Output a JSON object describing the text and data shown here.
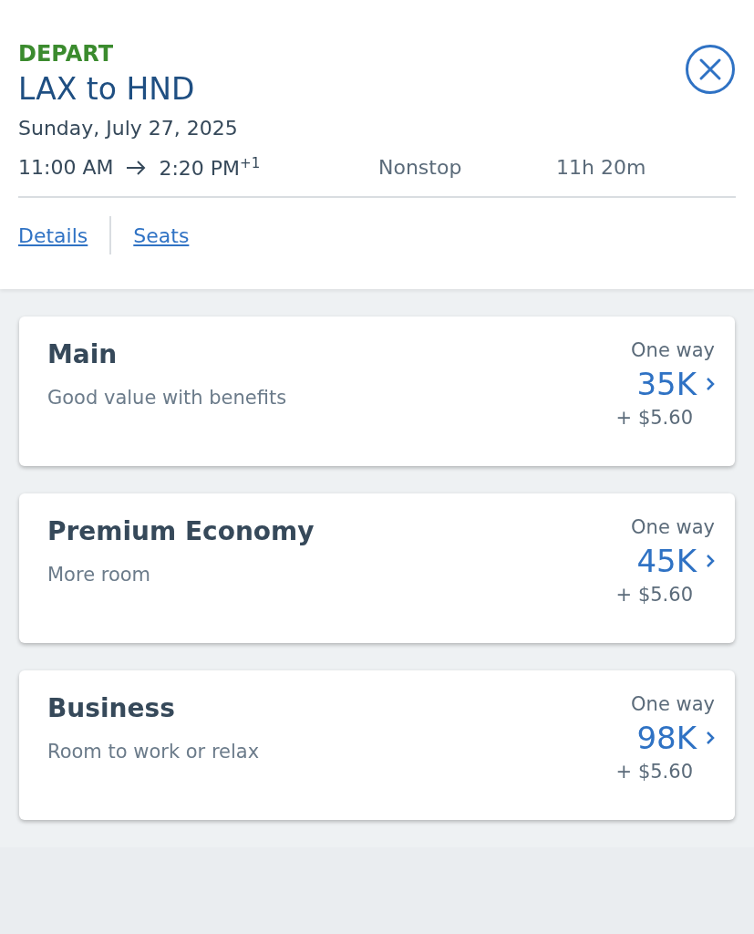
{
  "header": {
    "label": "DEPART",
    "route": "LAX to HND",
    "date": "Sunday, July 27, 2025",
    "depart_time": "11:00 AM",
    "arrive_time": "2:20 PM$^{+1}$",
    "stops": "Nonstop",
    "duration": "11h 20m",
    "links": [
      "Details",
      "Seats"
    ]
  },
  "fares": [
    {
      "cabin": "Main",
      "description": "Good value with benefits",
      "trip": "One way",
      "price": "35K",
      "fees": "+ $5.60"
    },
    {
      "cabin": "Premium Economy",
      "description": "More room",
      "trip": "One way",
      "price": "45K",
      "fees": "+ $5.60"
    },
    {
      "cabin": "Business",
      "description": "Room to work or relax",
      "trip": "One way",
      "price": "98K",
      "fees": "+ $5.60"
    }
  ]
}
